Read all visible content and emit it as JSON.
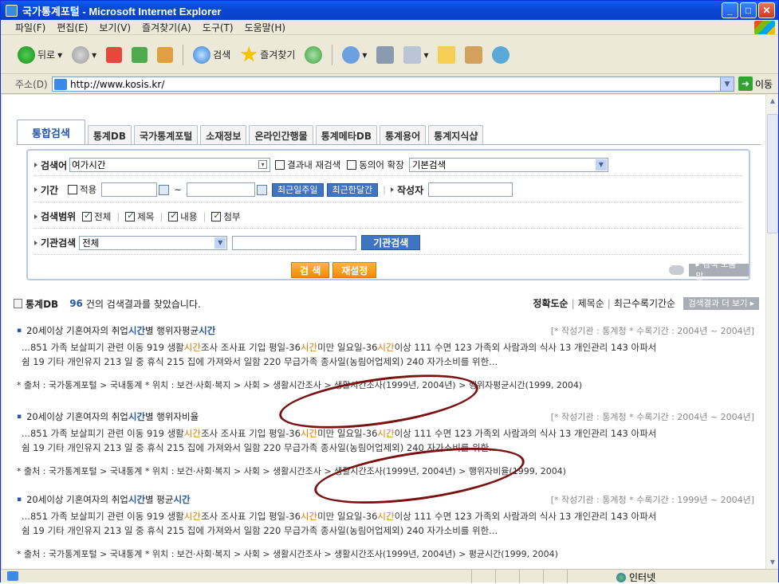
{
  "window": {
    "title": "국가통계포털 - Microsoft Internet Explorer"
  },
  "menu": [
    "파일(F)",
    "편집(E)",
    "보기(V)",
    "즐겨찾기(A)",
    "도구(T)",
    "도움말(H)"
  ],
  "toolbar": {
    "back": "뒤로",
    "search": "검색",
    "favorites": "즐겨찾기"
  },
  "address": {
    "label": "주소(D)",
    "url": "http://www.kosis.kr/",
    "go": "이동"
  },
  "status": {
    "zone": "인터넷"
  },
  "tabs": [
    "통합검색",
    "통계DB",
    "국가통계포털",
    "소재정보",
    "온라인간행물",
    "통계메타DB",
    "통계용어",
    "통계지식샵"
  ],
  "search": {
    "keyword_label": "검색어",
    "keyword_value": "여가시간",
    "within_results": "결과내 재검색",
    "synonym": "동의어 확장",
    "mode_value": "기본검색",
    "period_label": "기간",
    "apply": "적용",
    "tilde": "~",
    "recent_week": "최근일주일",
    "recent_two_months": "최근한달간",
    "author_label": "작성자",
    "scope_label": "검색범위",
    "scope_items": [
      "전체",
      "제목",
      "내용",
      "첨부"
    ],
    "org_label": "기관검색",
    "org_value": "전체",
    "org_button": "기관검색",
    "search_button": "검 색",
    "reset_button": "재설정",
    "help_button": "▸ 검색 도움말"
  },
  "results_header": {
    "db_label": "통계DB",
    "count": "96",
    "count_text": "건의 검색결과를 찾았습니다.",
    "sort_accuracy": "정확도순",
    "sort_title": "제목순",
    "sort_recent": "최근수록기간순",
    "more_button": "검색결과 더 보기 ▸"
  },
  "results": [
    {
      "title_a": "20세이상 기혼여자의 취업",
      "title_kw1": "시간",
      "title_b": "별 행위자평균",
      "title_kw2": "시간",
      "meta": "[* 작성기관 : 통계청  * 수록기간 : 2004년 ~ 2004년]",
      "snip1a": "...851 가족 보살피기 관련 이동 919 생활",
      "snip1kw1": "시간",
      "snip1b": "조사 조사표 기입 평일-36",
      "snip1kw2": "시간",
      "snip1c": "미만 일요일-36",
      "snip1kw3": "시간",
      "snip1d": "이상 111 수면 123 가족외 사람과의 식사 13 개인관리 143 아파서",
      "snip2": "쉼 19 기타 개인유지 213 일 중 휴식 215 집에 가져와서 일함 220 무급가족 종사일(농림어업제외) 240 자가소비를 위한...",
      "source": "* 출처 : 국가통계포털 > 국내통계    * 위치 : 보건·사회·복지 > 사회 > 생활시간조사 > 생활시간조사(1999년, 2004년) > 행위자평균시간(1999, 2004)"
    },
    {
      "title_a": "20세이상 기혼여자의 취업",
      "title_kw1": "시간",
      "title_b": "별 행위자비율",
      "title_kw2": "",
      "meta": "[* 작성기관 : 통계청  * 수록기간 : 2004년 ~ 2004년]",
      "snip1a": "...851 가족 보살피기 관련 이동 919 생활",
      "snip1kw1": "시간",
      "snip1b": "조사 조사표 기입 평일-36",
      "snip1kw2": "시간",
      "snip1c": "미만 일요일-36",
      "snip1kw3": "시간",
      "snip1d": "이상 111 수면 123 가족외 사람과의 식사 13 개인관리 143 아파서",
      "snip2": "쉼 19 기타 개인유지 213 일 중 휴식 215 집에 가져와서 일함 220 무급가족 종사일(농림어업제외) 240 자가소비를 위한...",
      "source": "* 출처 : 국가통계포털 > 국내통계    * 위치 : 보건·사회·복지 > 사회 > 생활시간조사 > 생활시간조사(1999년, 2004년) > 행위자비율(1999, 2004)"
    },
    {
      "title_a": "20세이상 기혼여자의 취업",
      "title_kw1": "시간",
      "title_b": "별 평균",
      "title_kw2": "시간",
      "meta": "[* 작성기관 : 통계청  * 수록기간 : 1999년 ~ 2004년]",
      "snip1a": "...851 가족 보살피기 관련 이동 919 생활",
      "snip1kw1": "시간",
      "snip1b": "조사 조사표 기입 평일-36",
      "snip1kw2": "시간",
      "snip1c": "미만 일요일-36",
      "snip1kw3": "시간",
      "snip1d": "이상 111 수면 123 가족외 사람과의 식사 13 개인관리 143 아파서",
      "snip2": "쉼 19 기타 개인유지 213 일 중 휴식 215 집에 가져와서 일함 220 무급가족 종사일(농림어업제외) 240 자가소비를 위한...",
      "source": "* 출처 : 국가통계포털 > 국내통계    * 위치 : 보건·사회·복지 > 사회 > 생활시간조사 > 생활시간조사(1999년, 2004년) > 평균시간(1999, 2004)"
    }
  ]
}
